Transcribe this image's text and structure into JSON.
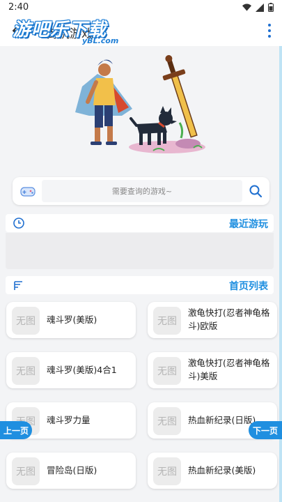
{
  "status_bar": {
    "time": "2:40"
  },
  "app_bar": {
    "title": "街机游戏"
  },
  "watermark": {
    "main": "游吧乐下载",
    "sub": "yBL.com"
  },
  "search": {
    "placeholder": "需要查询的游戏~"
  },
  "recent": {
    "title": "最近游玩"
  },
  "home_list": {
    "title": "首页列表",
    "thumb_placeholder": "无图",
    "games": [
      {
        "name": "魂斗罗(美版)"
      },
      {
        "name": "激龟快打(忍者神龟格斗)欧版"
      },
      {
        "name": "魂斗罗(美版)4合1"
      },
      {
        "name": "激龟快打(忍者神龟格斗)美版"
      },
      {
        "name": "魂斗罗力量"
      },
      {
        "name": "热血新纪录(日版)"
      },
      {
        "name": "冒险岛(日版)"
      },
      {
        "name": "热血新纪录(美版)"
      }
    ]
  },
  "pagination": {
    "prev": "上一页",
    "next": "下一页"
  },
  "colors": {
    "accent": "#1f8fe0",
    "watermark": "#1f7fd6"
  },
  "icons": {
    "status": [
      "wifi-icon",
      "signal-icon",
      "battery-icon"
    ],
    "back": "arrow-left-icon",
    "more": "more-vertical-icon",
    "search_left": "gamepad-icon",
    "search_right": "search-icon",
    "recent": "clock-icon",
    "list": "list-icon"
  }
}
